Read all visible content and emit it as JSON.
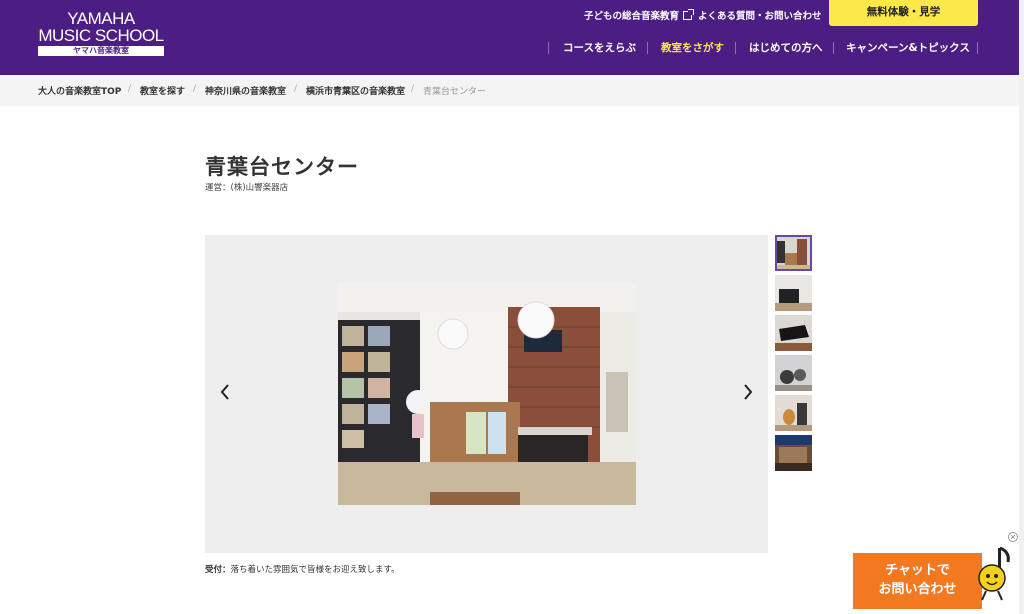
{
  "header": {
    "logo": {
      "line1": "YAMAHA",
      "line2": "MUSIC SCHOOL",
      "sub": "ヤマハ音楽教室"
    },
    "util_links": [
      "子どもの総合音楽教育",
      "よくある質問・お問い合わせ"
    ],
    "trial_button": "無料体験・見学",
    "nav": [
      {
        "label": "コースをえらぶ",
        "active": false
      },
      {
        "label": "教室をさがす",
        "active": true
      },
      {
        "label": "はじめての方へ",
        "active": false
      },
      {
        "label": "キャンペーン&トピックス",
        "active": false
      }
    ],
    "colors": {
      "brand": "#4c1e83",
      "accent": "#fde84a"
    }
  },
  "breadcrumb": [
    "大人の音楽教室TOP",
    "教室を探す",
    "神奈川県の音楽教室",
    "横浜市青葉区の音楽教室",
    "青葉台センター"
  ],
  "page": {
    "title": "青葉台センター",
    "operator": "運営：(株)山響楽器店"
  },
  "gallery": {
    "prev_icon": "chevron-left-icon",
    "next_icon": "chevron-right-icon",
    "thumbnail_count": 6,
    "selected_index": 0
  },
  "caption": {
    "label": "受付：",
    "text": "落ち着いた雰囲気で皆様をお迎え致します。"
  },
  "chat": {
    "line1": "チャットで",
    "line2": "お問い合わせ",
    "close": "×",
    "color": "#f37920"
  }
}
